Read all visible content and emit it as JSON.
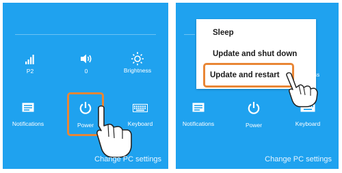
{
  "left_panel": {
    "network": {
      "label": "P2",
      "icon": "signal-bars-icon"
    },
    "volume": {
      "label": "0",
      "icon": "speaker-icon"
    },
    "brightness": {
      "label": "Brightness",
      "icon": "sun-icon"
    },
    "notifications": {
      "label": "Notifications",
      "icon": "notifications-icon"
    },
    "power": {
      "label": "Power",
      "icon": "power-icon"
    },
    "keyboard": {
      "label": "Keyboard",
      "icon": "keyboard-icon"
    },
    "change_settings": "Change PC settings"
  },
  "right_panel": {
    "power_menu": {
      "items": [
        {
          "label": "Sleep"
        },
        {
          "label": "Update and shut down"
        },
        {
          "label": "Update and restart"
        }
      ]
    },
    "brightness_partial": "ess",
    "notifications": {
      "label": "Notifications",
      "icon": "notifications-icon"
    },
    "power": {
      "label": "Power",
      "icon": "power-icon"
    },
    "keyboard": {
      "label": "Keyboard",
      "icon": "keyboard-icon"
    },
    "change_settings": "Change PC settings"
  },
  "colors": {
    "panel": "#1fa2ef",
    "highlight": "#e98635",
    "text": "#ffffff",
    "menu_bg": "#ffffff"
  }
}
